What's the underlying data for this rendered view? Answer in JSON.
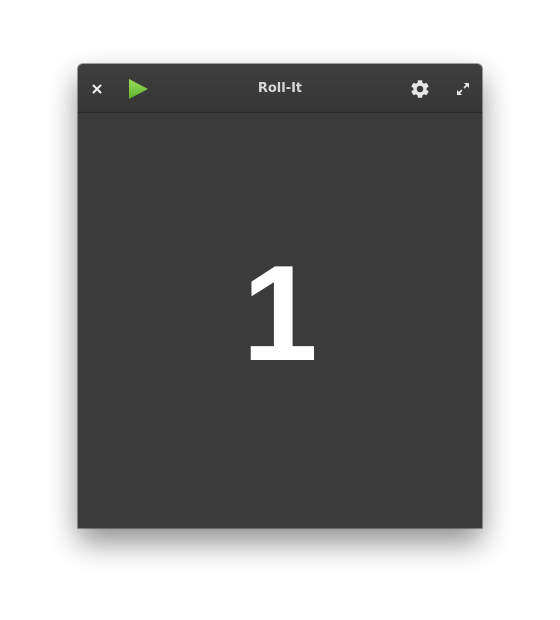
{
  "window": {
    "title": "Roll-It"
  },
  "toolbar": {
    "close_icon": "close-icon",
    "play_icon": "play-icon",
    "settings_icon": "gear-icon",
    "maximize_icon": "maximize-icon",
    "play_color": "#7ac943"
  },
  "main": {
    "roll_result": "1"
  }
}
